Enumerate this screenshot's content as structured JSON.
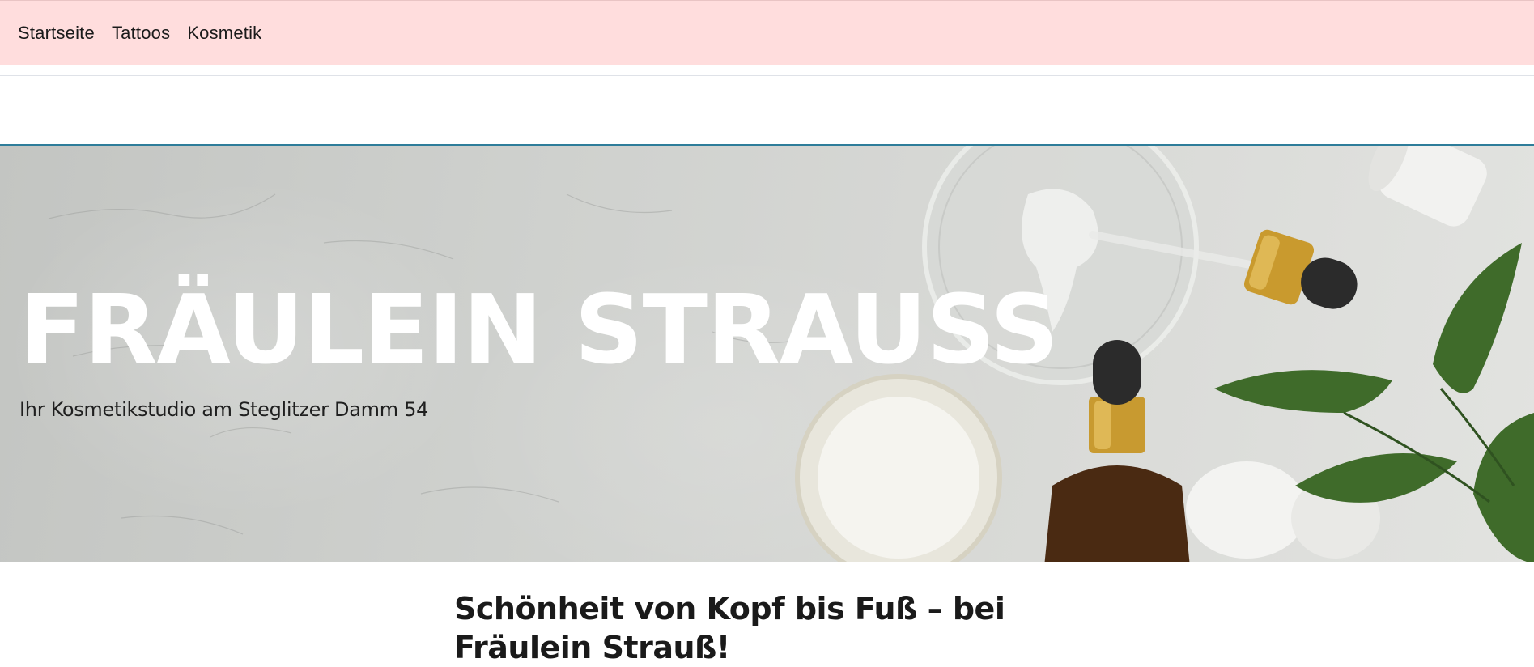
{
  "nav": {
    "items": [
      {
        "label": "Startseite"
      },
      {
        "label": "Tattoos"
      },
      {
        "label": "Kosmetik"
      }
    ]
  },
  "hero": {
    "title": "FRÄULEIN STRAUSS",
    "subtitle": "Ihr Kosmetikstudio am Steglitzer Damm 54"
  },
  "intro": {
    "heading": "Schönheit von Kopf bis Fuß – bei Fräulein Strauß!"
  },
  "colors": {
    "nav_background": "#ffdddd",
    "hero_border": "#2e7d9a",
    "hero_title": "#ffffff"
  }
}
